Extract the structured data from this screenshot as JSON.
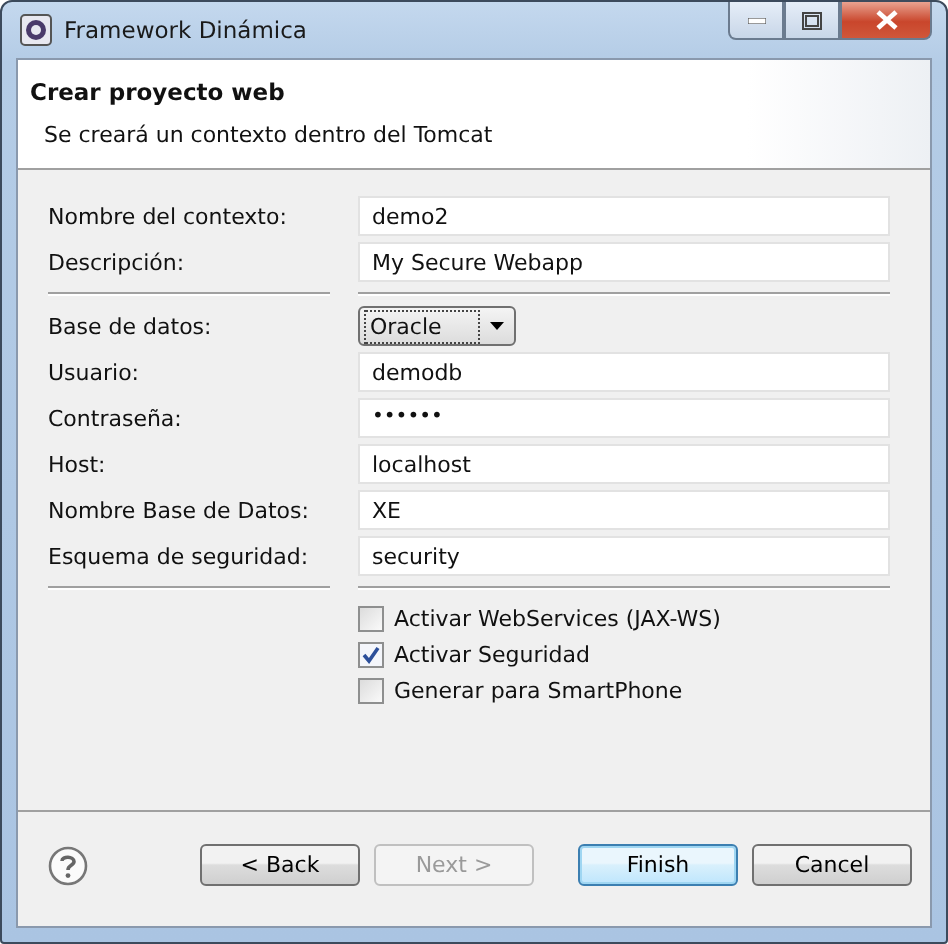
{
  "window": {
    "title": "Framework Dinámica"
  },
  "header": {
    "title": "Crear proyecto web",
    "description": "Se creará un contexto dentro del Tomcat"
  },
  "field_groups": [
    [
      {
        "kind": "text",
        "label": "Nombre del contexto:",
        "value": "demo2"
      },
      {
        "kind": "text",
        "label": "Descripción:",
        "value": "My Secure Webapp"
      }
    ],
    [
      {
        "kind": "dropdown",
        "label": "Base de datos:",
        "value": "Oracle"
      },
      {
        "kind": "text",
        "label": "Usuario:",
        "value": "demodb"
      },
      {
        "kind": "password",
        "label": "Contraseña:",
        "value": "••••••"
      },
      {
        "kind": "text",
        "label": "Host:",
        "value": "localhost"
      },
      {
        "kind": "text",
        "label": "Nombre Base de Datos:",
        "value": "XE"
      },
      {
        "kind": "text",
        "label": "Esquema de seguridad:",
        "value": "security"
      }
    ]
  ],
  "options": [
    {
      "label": "Activar WebServices (JAX-WS)",
      "checked": false
    },
    {
      "label": "Activar Seguridad",
      "checked": true
    },
    {
      "label": "Generar para SmartPhone",
      "checked": false
    }
  ],
  "buttons": [
    {
      "label": "< Back",
      "disabled": false,
      "default": false
    },
    {
      "label": "Next >",
      "disabled": true,
      "default": false
    },
    {
      "label": "Finish",
      "disabled": false,
      "default": true
    },
    {
      "label": "Cancel",
      "disabled": false,
      "default": false
    }
  ]
}
